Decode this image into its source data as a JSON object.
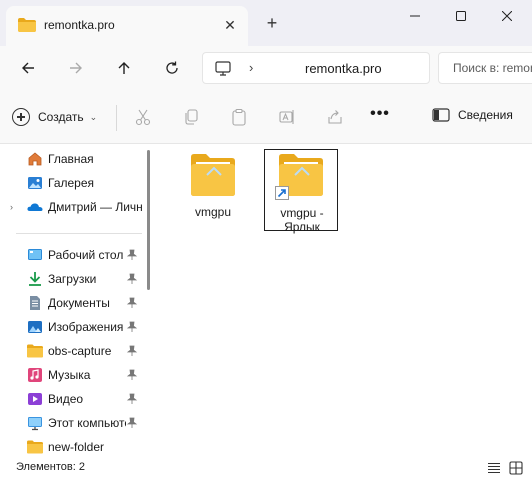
{
  "window": {
    "tab_title": "remontka.pro",
    "new_tab_symbol": "+",
    "tab_close_symbol": "✕"
  },
  "address": {
    "path": "remontka.pro",
    "search_placeholder": "Поиск в: remontka.pro"
  },
  "toolbar": {
    "create_label": "Создать",
    "more_label": "•••",
    "details_label": "Сведения",
    "icons": [
      "cut-icon",
      "copy-icon",
      "paste-icon",
      "rename-icon",
      "share-icon",
      "delete-icon"
    ]
  },
  "sidebar": {
    "items": [
      {
        "label": "Главная",
        "icon": "home-icon"
      },
      {
        "label": "Галерея",
        "icon": "gallery-icon"
      },
      {
        "label": "Дмитрий — Личный",
        "icon": "onedrive-icon"
      },
      {
        "label": "Рабочий стол",
        "icon": "desktop-icon",
        "pinned": true
      },
      {
        "label": "Загрузки",
        "icon": "downloads-icon",
        "pinned": true
      },
      {
        "label": "Документы",
        "icon": "documents-icon",
        "pinned": true
      },
      {
        "label": "Изображения",
        "icon": "pictures-icon",
        "pinned": true
      },
      {
        "label": "obs-capture",
        "icon": "folder-icon",
        "pinned": true
      },
      {
        "label": "Музыка",
        "icon": "music-icon",
        "pinned": true
      },
      {
        "label": "Видео",
        "icon": "videos-icon",
        "pinned": true
      },
      {
        "label": "Этот компьютер",
        "icon": "this-pc-icon",
        "pinned": true
      },
      {
        "label": "new-folder",
        "icon": "folder-icon",
        "pinned": false
      }
    ]
  },
  "files": [
    {
      "name": "vmgpu",
      "type": "folder",
      "selected": false
    },
    {
      "name": "vmgpu - Ярлык",
      "type": "shortcut",
      "selected": true
    }
  ],
  "status": {
    "text": "Элементов: 2"
  },
  "colors": {
    "folder": "#f8c544",
    "folder_dark": "#e9a91c",
    "accent": "#0067c0"
  }
}
